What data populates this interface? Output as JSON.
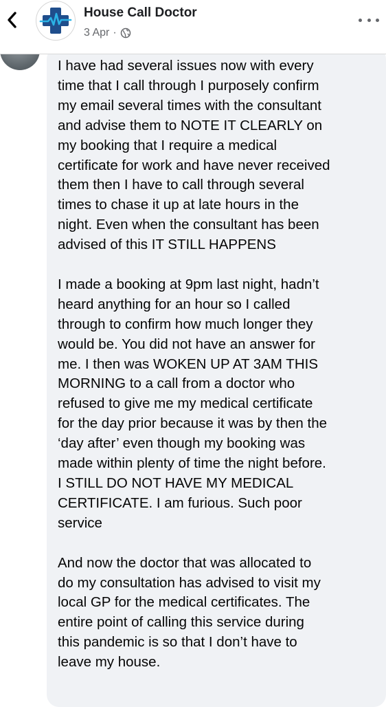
{
  "header": {
    "back_icon": "chevron-left-icon",
    "logo_icon": "medical-cross-heartbeat-logo",
    "title": "House Call Doctor",
    "date": "3 Apr",
    "separator": "·",
    "privacy_icon": "globe-icon",
    "more_icon": "more-options-icon"
  },
  "comment": {
    "paragraphs": [
      "I have had several issues now with every\ntime that I call through I purposely confirm\nmy email several times with the consultant\nand advise them to NOTE IT CLEARLY on\nmy booking that I require a medical\ncertificate for work and have never received\nthem then I have to call through several\ntimes to chase it up at late hours in the\nnight. Even when the consultant has been\nadvised of this IT STILL HAPPENS",
      "I made a booking at 9pm last night, hadn’t\nheard anything for an hour so I called\nthrough to confirm how much longer they\nwould be. You did not have an answer for\nme. I then was WOKEN UP AT 3AM THIS\nMORNING to a call from a doctor who\nrefused to give me my medical certificate\nfor the day prior because it was by then the\n‘day after’ even though my booking was\nmade within plenty of time the night before.\nI STILL DO NOT HAVE MY MEDICAL\nCERTIFICATE. I am furious. Such poor\nservice",
      "And now the doctor that was allocated to\ndo my consultation has advised to visit my\nlocal GP for the medical certificates. The\nentire point of calling this service during\nthis pandemic is so that I don’t have to\nleave my house."
    ]
  },
  "colors": {
    "logo_blue": "#1f4e8c",
    "logo_heartbeat": "#2bb3e6",
    "bubble_bg": "#f0f2f5",
    "text": "#050505",
    "meta_text": "#65676b"
  }
}
